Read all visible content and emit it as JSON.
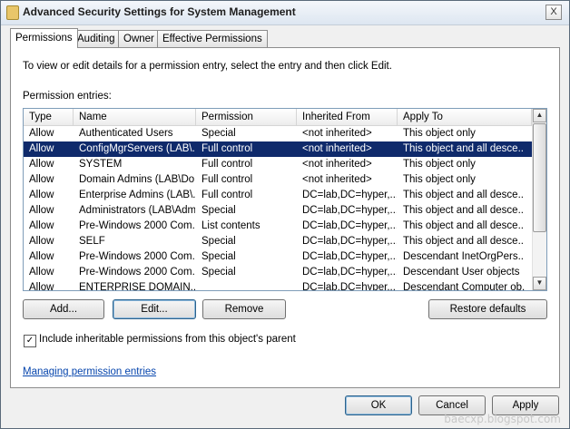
{
  "window": {
    "title": "Advanced Security Settings for System Management",
    "close_label": "X"
  },
  "tabs": [
    {
      "label": "Permissions"
    },
    {
      "label": "Auditing"
    },
    {
      "label": "Owner"
    },
    {
      "label": "Effective Permissions"
    }
  ],
  "permissions": {
    "intro_text": "To view or edit details for a permission entry, select the entry and then click Edit.",
    "entries_label": "Permission entries:",
    "columns": [
      "Type",
      "Name",
      "Permission",
      "Inherited From",
      "Apply To"
    ],
    "rows": [
      {
        "type": "Allow",
        "name": "Authenticated Users",
        "permission": "Special",
        "inherited_from": "<not inherited>",
        "apply_to": "This object only"
      },
      {
        "type": "Allow",
        "name": "ConfigMgrServers (LAB\\...",
        "permission": "Full control",
        "inherited_from": "<not inherited>",
        "apply_to": "This object and all desce..."
      },
      {
        "type": "Allow",
        "name": "SYSTEM",
        "permission": "Full control",
        "inherited_from": "<not inherited>",
        "apply_to": "This object only"
      },
      {
        "type": "Allow",
        "name": "Domain Admins (LAB\\Do...",
        "permission": "Full control",
        "inherited_from": "<not inherited>",
        "apply_to": "This object only"
      },
      {
        "type": "Allow",
        "name": "Enterprise Admins (LAB\\...",
        "permission": "Full control",
        "inherited_from": "DC=lab,DC=hyper,...",
        "apply_to": "This object and all desce..."
      },
      {
        "type": "Allow",
        "name": "Administrators (LAB\\Adm...",
        "permission": "Special",
        "inherited_from": "DC=lab,DC=hyper,...",
        "apply_to": "This object and all desce..."
      },
      {
        "type": "Allow",
        "name": "Pre-Windows 2000 Com...",
        "permission": "List contents",
        "inherited_from": "DC=lab,DC=hyper,...",
        "apply_to": "This object and all desce..."
      },
      {
        "type": "Allow",
        "name": "SELF",
        "permission": "Special",
        "inherited_from": "DC=lab,DC=hyper,...",
        "apply_to": "This object and all desce..."
      },
      {
        "type": "Allow",
        "name": "Pre-Windows 2000 Com...",
        "permission": "Special",
        "inherited_from": "DC=lab,DC=hyper,...",
        "apply_to": "Descendant InetOrgPers..."
      },
      {
        "type": "Allow",
        "name": "Pre-Windows 2000 Com...",
        "permission": "Special",
        "inherited_from": "DC=lab,DC=hyper,...",
        "apply_to": "Descendant User objects"
      },
      {
        "type": "Allow",
        "name": "ENTERPRISE DOMAIN...",
        "permission": "",
        "inherited_from": "DC=lab,DC=hyper...",
        "apply_to": "Descendant Computer ob..."
      }
    ],
    "selected_row": 1,
    "buttons": {
      "add": "Add...",
      "edit": "Edit...",
      "remove": "Remove",
      "restore": "Restore defaults"
    },
    "include_inheritable": {
      "label": "Include inheritable permissions from this object's parent",
      "checked": true
    },
    "help_link": "Managing permission entries"
  },
  "footer": {
    "ok": "OK",
    "cancel": "Cancel",
    "apply": "Apply"
  },
  "watermark": "baecxp.blogspot.com",
  "icons": {
    "check": "✓",
    "scroll_up": "▲",
    "scroll_down": "▼"
  },
  "colors": {
    "selection": "#0f2a6b",
    "link": "#0645ad"
  }
}
